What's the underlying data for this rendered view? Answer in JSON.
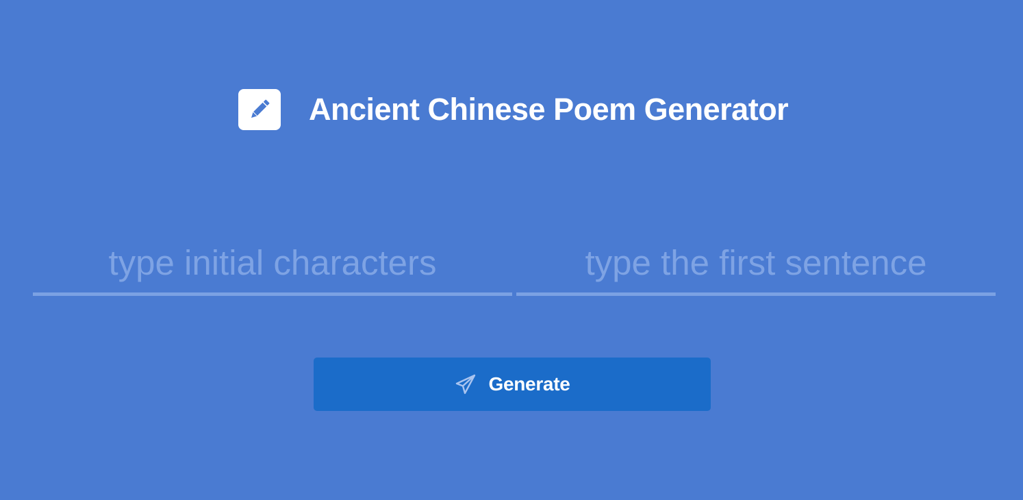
{
  "app": {
    "title": "Ancient Chinese Poem Generator",
    "logo_icon": "pencil-square-icon"
  },
  "inputs": {
    "initial_characters": {
      "value": "",
      "placeholder": "type initial characters"
    },
    "first_sentence": {
      "value": "",
      "placeholder": "type the first sentence"
    }
  },
  "actions": {
    "generate_label": "Generate",
    "generate_icon": "paper-plane-icon"
  },
  "colors": {
    "background": "#4a7bd2",
    "button": "#1b6cc9",
    "input_underline": "#7ba1e3",
    "placeholder": "#7ea3e4",
    "text": "#ffffff"
  }
}
